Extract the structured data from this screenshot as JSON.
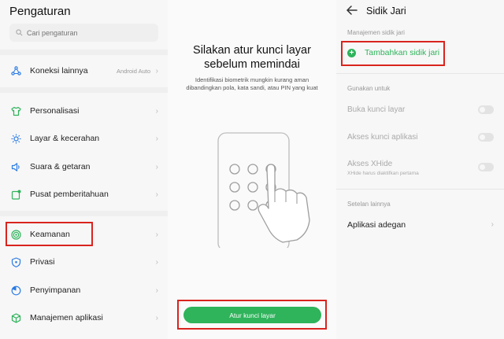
{
  "settings": {
    "title": "Pengaturan",
    "search_placeholder": "Cari pengaturan",
    "items": [
      {
        "label": "Koneksi lainnya",
        "sub": "Android Auto",
        "icon": "share-icon"
      },
      {
        "label": "Personalisasi",
        "icon": "shirt-icon"
      },
      {
        "label": "Layar & kecerahan",
        "icon": "sun-icon"
      },
      {
        "label": "Suara & getaran",
        "icon": "speaker-icon"
      },
      {
        "label": "Pusat pemberitahuan",
        "icon": "notification-icon"
      },
      {
        "label": "Keamanan",
        "icon": "target-icon"
      },
      {
        "label": "Privasi",
        "icon": "shield-icon"
      },
      {
        "label": "Penyimpanan",
        "icon": "pie-icon"
      },
      {
        "label": "Manajemen aplikasi",
        "icon": "cube-icon"
      }
    ]
  },
  "lock_prompt": {
    "title_line1": "Silakan atur kunci layar",
    "title_line2": "sebelum memindai",
    "description": "Identifikasi biometrik mungkin kurang aman dibandingkan pola, kata sandi, atau PIN yang kuat",
    "button_label": "Atur kunci layar"
  },
  "fingerprint": {
    "title": "Sidik Jari",
    "section_manage": "Manajemen sidik jari",
    "add_label": "Tambahkan sidik jari",
    "section_use": "Gunakan untuk",
    "toggles": [
      {
        "label": "Buka kunci layar",
        "enabled": false
      },
      {
        "label": "Akses kunci aplikasi",
        "enabled": false
      },
      {
        "label": "Akses XHide",
        "sub": "XHide harus diaktifkan pertama",
        "enabled": false
      }
    ],
    "section_other": "Setelan lainnya",
    "scene_app_label": "Aplikasi adegan"
  },
  "colors": {
    "accent_green": "#2fb35b",
    "highlight_red": "#d9241e",
    "icon_blue": "#2b7be4",
    "icon_green": "#2fb35b"
  }
}
